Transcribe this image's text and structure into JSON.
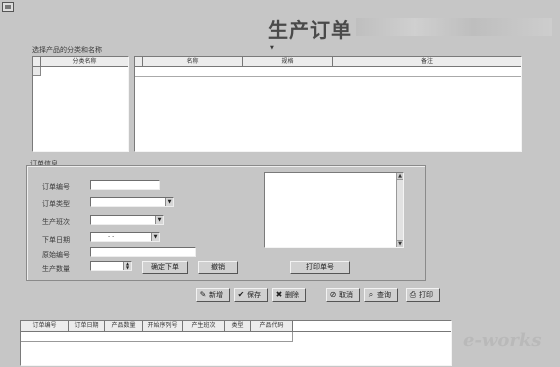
{
  "window": {
    "title": "生产订单"
  },
  "product_section": {
    "label": "选择产品的分类和名称",
    "category_header": "分类名称",
    "product_columns": [
      "名称",
      "规格",
      "备注"
    ]
  },
  "order_section": {
    "label": "订单信息",
    "fields": {
      "order_no": "订单编号",
      "order_type": "订单类型",
      "production_line": "生产班次",
      "order_date": "下单日期",
      "plan_no": "原始编号",
      "quantity": "生产数量"
    },
    "date_value": "- -",
    "buttons": {
      "confirm": "确定下单",
      "cancel": "撤销",
      "print": "打印单号"
    }
  },
  "toolbar": [
    {
      "label": "新增",
      "icon": "add-icon"
    },
    {
      "label": "保存",
      "icon": "check-icon"
    },
    {
      "label": "删除",
      "icon": "delete-icon"
    },
    {
      "label": "取消",
      "icon": "cancel-icon"
    },
    {
      "label": "查询",
      "icon": "query-icon"
    },
    {
      "label": "打印",
      "icon": "print-icon"
    }
  ],
  "orders_table": {
    "columns": [
      "订单编号",
      "订单日期",
      "产品数量",
      "开始序列号",
      "产生班次",
      "类型",
      "产品代码"
    ]
  },
  "watermark": {
    "brand": "e-works",
    "sub": ""
  }
}
